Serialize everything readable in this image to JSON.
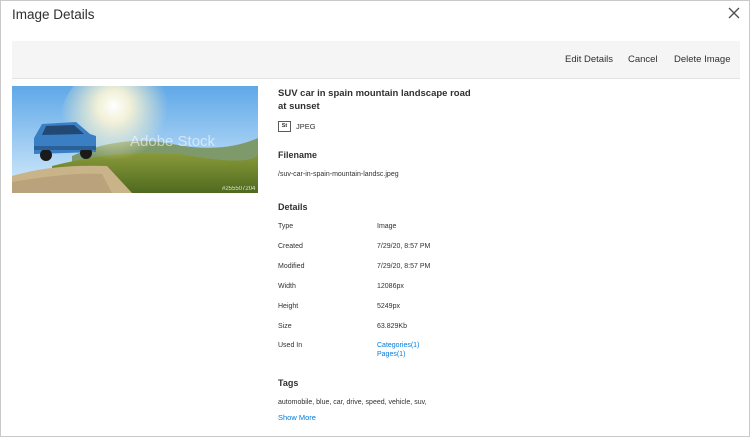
{
  "modal": {
    "title": "Image Details",
    "close_icon": "close-icon"
  },
  "toolbar": {
    "edit_label": "Edit Details",
    "cancel_label": "Cancel",
    "delete_label": "Delete Image"
  },
  "image": {
    "title": "SUV car in spain mountain landscape road at sunset",
    "badge": "St",
    "type_label": "JPEG",
    "watermark": "Adobe Stock",
    "stock_id": "#255507204"
  },
  "filename": {
    "heading": "Filename",
    "value": "/suv-car-in-spain-mountain-landsc.jpeg"
  },
  "details": {
    "heading": "Details",
    "rows": [
      {
        "label": "Type",
        "value": "Image"
      },
      {
        "label": "Created",
        "value": "7/29/20, 8:57 PM"
      },
      {
        "label": "Modified",
        "value": "7/29/20, 8:57 PM"
      },
      {
        "label": "Width",
        "value": "12086px"
      },
      {
        "label": "Height",
        "value": "5249px"
      },
      {
        "label": "Size",
        "value": "63.829Kb"
      },
      {
        "label": "Used In",
        "links": [
          "Categories(1)",
          "Pages(1)"
        ]
      }
    ]
  },
  "tags": {
    "heading": "Tags",
    "value": "automobile, blue, car, drive, speed, vehicle, suv,",
    "show_more": "Show More"
  },
  "colors": {
    "link": "#007bdb",
    "toolbar_bg": "#f5f5f5",
    "text": "#303030"
  }
}
